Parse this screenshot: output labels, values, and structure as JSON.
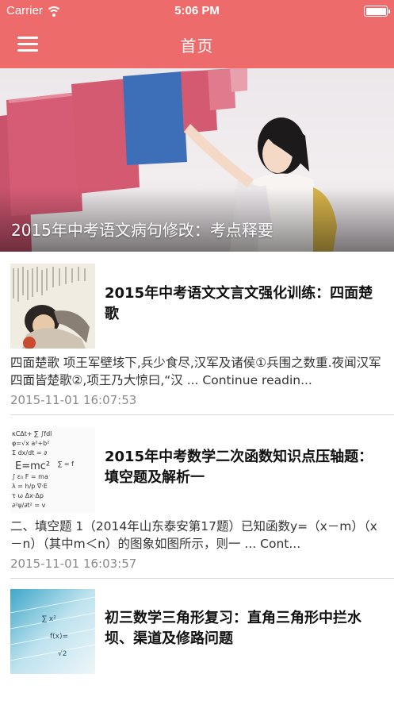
{
  "status_bar": {
    "carrier": "Carrier",
    "time": "5:06 PM",
    "wifi_icon": "wifi-icon",
    "battery_icon": "battery-icon"
  },
  "nav": {
    "menu_icon": "hamburger-menu-icon",
    "title": "首页"
  },
  "colors": {
    "accent": "#ee6b6b",
    "divider": "#d8d8d8",
    "date_gray": "#8a8a8a"
  },
  "banner": {
    "title": "2015年中考语文病句修改：考点释要"
  },
  "articles": [
    {
      "title": "2015年中考语文文言文强化训练：四面楚歌",
      "summary": "四面楚歌 项王军壁垓下,兵少食尽,汉军及诸侯①兵围之数重.夜闻汉军四面皆楚歌②,项王乃大惊曰,“汉 ... Continue readin...",
      "date": "2015-11-01 16:07:53"
    },
    {
      "title": "2015年中考数学二次函数知识点压轴题：填空题及解析一",
      "summary": "二、填空题 1（2014年山东泰安第17题）已知函数y=（x－m）（x－n）（其中m＜n）的图象如图所示，则一 ... Cont...",
      "date": "2015-11-01 16:03:57"
    },
    {
      "title": "初三数学三角形复习：直角三角形中拦水坝、渠道及修路问题"
    }
  ]
}
